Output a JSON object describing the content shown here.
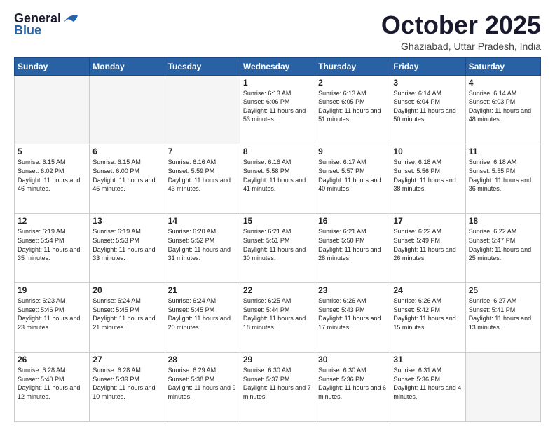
{
  "header": {
    "logo_line1": "General",
    "logo_line2": "Blue",
    "month": "October 2025",
    "location": "Ghaziabad, Uttar Pradesh, India"
  },
  "days_header": [
    "Sunday",
    "Monday",
    "Tuesday",
    "Wednesday",
    "Thursday",
    "Friday",
    "Saturday"
  ],
  "weeks": [
    {
      "rowClass": "row1",
      "days": [
        {
          "num": "",
          "empty": true
        },
        {
          "num": "",
          "empty": true
        },
        {
          "num": "",
          "empty": true
        },
        {
          "num": "1",
          "sunrise": "Sunrise: 6:13 AM",
          "sunset": "Sunset: 6:06 PM",
          "daylight": "Daylight: 11 hours and 53 minutes."
        },
        {
          "num": "2",
          "sunrise": "Sunrise: 6:13 AM",
          "sunset": "Sunset: 6:05 PM",
          "daylight": "Daylight: 11 hours and 51 minutes."
        },
        {
          "num": "3",
          "sunrise": "Sunrise: 6:14 AM",
          "sunset": "Sunset: 6:04 PM",
          "daylight": "Daylight: 11 hours and 50 minutes."
        },
        {
          "num": "4",
          "sunrise": "Sunrise: 6:14 AM",
          "sunset": "Sunset: 6:03 PM",
          "daylight": "Daylight: 11 hours and 48 minutes."
        }
      ]
    },
    {
      "rowClass": "row2",
      "days": [
        {
          "num": "5",
          "sunrise": "Sunrise: 6:15 AM",
          "sunset": "Sunset: 6:02 PM",
          "daylight": "Daylight: 11 hours and 46 minutes."
        },
        {
          "num": "6",
          "sunrise": "Sunrise: 6:15 AM",
          "sunset": "Sunset: 6:00 PM",
          "daylight": "Daylight: 11 hours and 45 minutes."
        },
        {
          "num": "7",
          "sunrise": "Sunrise: 6:16 AM",
          "sunset": "Sunset: 5:59 PM",
          "daylight": "Daylight: 11 hours and 43 minutes."
        },
        {
          "num": "8",
          "sunrise": "Sunrise: 6:16 AM",
          "sunset": "Sunset: 5:58 PM",
          "daylight": "Daylight: 11 hours and 41 minutes."
        },
        {
          "num": "9",
          "sunrise": "Sunrise: 6:17 AM",
          "sunset": "Sunset: 5:57 PM",
          "daylight": "Daylight: 11 hours and 40 minutes."
        },
        {
          "num": "10",
          "sunrise": "Sunrise: 6:18 AM",
          "sunset": "Sunset: 5:56 PM",
          "daylight": "Daylight: 11 hours and 38 minutes."
        },
        {
          "num": "11",
          "sunrise": "Sunrise: 6:18 AM",
          "sunset": "Sunset: 5:55 PM",
          "daylight": "Daylight: 11 hours and 36 minutes."
        }
      ]
    },
    {
      "rowClass": "row3",
      "days": [
        {
          "num": "12",
          "sunrise": "Sunrise: 6:19 AM",
          "sunset": "Sunset: 5:54 PM",
          "daylight": "Daylight: 11 hours and 35 minutes."
        },
        {
          "num": "13",
          "sunrise": "Sunrise: 6:19 AM",
          "sunset": "Sunset: 5:53 PM",
          "daylight": "Daylight: 11 hours and 33 minutes."
        },
        {
          "num": "14",
          "sunrise": "Sunrise: 6:20 AM",
          "sunset": "Sunset: 5:52 PM",
          "daylight": "Daylight: 11 hours and 31 minutes."
        },
        {
          "num": "15",
          "sunrise": "Sunrise: 6:21 AM",
          "sunset": "Sunset: 5:51 PM",
          "daylight": "Daylight: 11 hours and 30 minutes."
        },
        {
          "num": "16",
          "sunrise": "Sunrise: 6:21 AM",
          "sunset": "Sunset: 5:50 PM",
          "daylight": "Daylight: 11 hours and 28 minutes."
        },
        {
          "num": "17",
          "sunrise": "Sunrise: 6:22 AM",
          "sunset": "Sunset: 5:49 PM",
          "daylight": "Daylight: 11 hours and 26 minutes."
        },
        {
          "num": "18",
          "sunrise": "Sunrise: 6:22 AM",
          "sunset": "Sunset: 5:47 PM",
          "daylight": "Daylight: 11 hours and 25 minutes."
        }
      ]
    },
    {
      "rowClass": "row4",
      "days": [
        {
          "num": "19",
          "sunrise": "Sunrise: 6:23 AM",
          "sunset": "Sunset: 5:46 PM",
          "daylight": "Daylight: 11 hours and 23 minutes."
        },
        {
          "num": "20",
          "sunrise": "Sunrise: 6:24 AM",
          "sunset": "Sunset: 5:45 PM",
          "daylight": "Daylight: 11 hours and 21 minutes."
        },
        {
          "num": "21",
          "sunrise": "Sunrise: 6:24 AM",
          "sunset": "Sunset: 5:45 PM",
          "daylight": "Daylight: 11 hours and 20 minutes."
        },
        {
          "num": "22",
          "sunrise": "Sunrise: 6:25 AM",
          "sunset": "Sunset: 5:44 PM",
          "daylight": "Daylight: 11 hours and 18 minutes."
        },
        {
          "num": "23",
          "sunrise": "Sunrise: 6:26 AM",
          "sunset": "Sunset: 5:43 PM",
          "daylight": "Daylight: 11 hours and 17 minutes."
        },
        {
          "num": "24",
          "sunrise": "Sunrise: 6:26 AM",
          "sunset": "Sunset: 5:42 PM",
          "daylight": "Daylight: 11 hours and 15 minutes."
        },
        {
          "num": "25",
          "sunrise": "Sunrise: 6:27 AM",
          "sunset": "Sunset: 5:41 PM",
          "daylight": "Daylight: 11 hours and 13 minutes."
        }
      ]
    },
    {
      "rowClass": "row5",
      "days": [
        {
          "num": "26",
          "sunrise": "Sunrise: 6:28 AM",
          "sunset": "Sunset: 5:40 PM",
          "daylight": "Daylight: 11 hours and 12 minutes."
        },
        {
          "num": "27",
          "sunrise": "Sunrise: 6:28 AM",
          "sunset": "Sunset: 5:39 PM",
          "daylight": "Daylight: 11 hours and 10 minutes."
        },
        {
          "num": "28",
          "sunrise": "Sunrise: 6:29 AM",
          "sunset": "Sunset: 5:38 PM",
          "daylight": "Daylight: 11 hours and 9 minutes."
        },
        {
          "num": "29",
          "sunrise": "Sunrise: 6:30 AM",
          "sunset": "Sunset: 5:37 PM",
          "daylight": "Daylight: 11 hours and 7 minutes."
        },
        {
          "num": "30",
          "sunrise": "Sunrise: 6:30 AM",
          "sunset": "Sunset: 5:36 PM",
          "daylight": "Daylight: 11 hours and 6 minutes."
        },
        {
          "num": "31",
          "sunrise": "Sunrise: 6:31 AM",
          "sunset": "Sunset: 5:36 PM",
          "daylight": "Daylight: 11 hours and 4 minutes."
        },
        {
          "num": "",
          "empty": true
        }
      ]
    }
  ]
}
